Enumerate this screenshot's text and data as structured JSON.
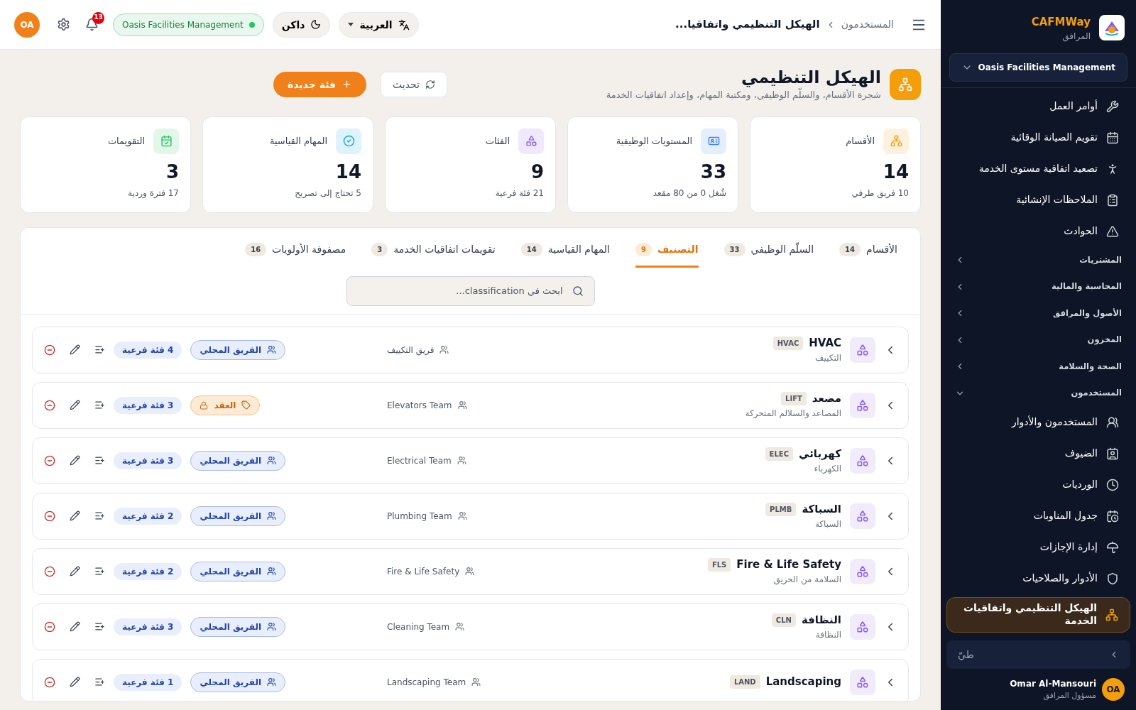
{
  "header": {
    "breadcrumb": [
      "المستخدمون",
      "الهيكل التنظيمي واتفاقيا..."
    ],
    "language": "العربية",
    "theme": "داكن",
    "org_status": "Oasis Facilities Management",
    "notifications": "13",
    "avatar": "OA"
  },
  "page": {
    "title": "الهيكل التنظيمي",
    "subtitle": "شجرة الأقسام، والسلّم الوظيفي، ومكتبة المهام، وإعداد اتفاقيات الخدمة",
    "refresh": "تحديث",
    "new_button": "فئة جديدة"
  },
  "stats": [
    {
      "label": "الأقسام",
      "value": "14",
      "note": "10 فريق طرفي",
      "color": "#f59e0b"
    },
    {
      "label": "المستويات الوظيفية",
      "value": "33",
      "note": "شُغل 0 من 80 مقعد",
      "color": "#3b82f6"
    },
    {
      "label": "الفئات",
      "value": "9",
      "note": "21 فئة فرعية",
      "color": "#8b5cf6"
    },
    {
      "label": "المهام القياسية",
      "value": "14",
      "note": "5 تحتاج إلى تصريح",
      "color": "#0ea5e9"
    },
    {
      "label": "التقويمات",
      "value": "3",
      "note": "17 فترة وردية",
      "color": "#22c55e"
    }
  ],
  "tabs": [
    {
      "label": "الأقسام",
      "count": "14",
      "selected": false
    },
    {
      "label": "السلّم الوظيفي",
      "count": "33",
      "selected": false
    },
    {
      "label": "التصنيف",
      "count": "9",
      "selected": true
    },
    {
      "label": "المهام القياسية",
      "count": "14",
      "selected": false
    },
    {
      "label": "تقويمات اتفاقيات الخدمة",
      "count": "3",
      "selected": false
    },
    {
      "label": "مصفوفة الأولويات",
      "count": "16",
      "selected": false
    }
  ],
  "search": {
    "placeholder": "ابحث في classification..."
  },
  "rows": [
    {
      "name": "HVAC",
      "code": "HVAC",
      "subtitle": "التكييف",
      "team": "فريق التكييف",
      "badge": {
        "kind": "local",
        "label": "الفريق المحلي"
      },
      "subcategories": "4 فئة فرعية"
    },
    {
      "name": "مصعد",
      "code": "LIFT",
      "subtitle": "المصاعد والسلالم المتحركة",
      "team": "Elevators Team",
      "badge": {
        "kind": "contract",
        "label": "العقد"
      },
      "subcategories": "3 فئة فرعية"
    },
    {
      "name": "كهربائي",
      "code": "ELEC",
      "subtitle": "الكهرباء",
      "team": "Electrical Team",
      "badge": {
        "kind": "local",
        "label": "الفريق المحلي"
      },
      "subcategories": "3 فئة فرعية"
    },
    {
      "name": "السباكة",
      "code": "PLMB",
      "subtitle": "السباكة",
      "team": "Plumbing Team",
      "badge": {
        "kind": "local",
        "label": "الفريق المحلي"
      },
      "subcategories": "2 فئة فرعية"
    },
    {
      "name": "Fire & Life Safety",
      "code": "FLS",
      "subtitle": "السلامة من الحريق",
      "team": "Fire & Life Safety",
      "badge": {
        "kind": "local",
        "label": "الفريق المحلي"
      },
      "subcategories": "2 فئة فرعية"
    },
    {
      "name": "النظافة",
      "code": "CLN",
      "subtitle": "النظافة",
      "team": "Cleaning Team",
      "badge": {
        "kind": "local",
        "label": "الفريق المحلي"
      },
      "subcategories": "3 فئة فرعية"
    },
    {
      "name": "Landscaping",
      "code": "LAND",
      "team": "Landscaping Team",
      "badge": {
        "kind": "local",
        "label": "الفريق المحلي"
      },
      "subcategories": "1 فئة فرعية"
    }
  ],
  "sidebar": {
    "brand": "CAFMWay",
    "brand_sub": "المرافق",
    "org": "Oasis Facilities Management",
    "items": [
      {
        "kind": "link",
        "label": "أوامر العمل",
        "selected": false
      },
      {
        "kind": "link",
        "label": "تقويم الصيانة الوقائية",
        "selected": false
      },
      {
        "kind": "link",
        "label": "تصعيد اتفاقية مستوى الخدمة",
        "selected": false
      },
      {
        "kind": "link",
        "label": "الملاحظات الإنشائية",
        "selected": false
      },
      {
        "kind": "link",
        "label": "الحوادث",
        "selected": false
      },
      {
        "kind": "section",
        "label": "المشتريات",
        "expanded": false
      },
      {
        "kind": "section",
        "label": "المحاسبة والمالية",
        "expanded": false
      },
      {
        "kind": "section",
        "label": "الأصول والمرافق",
        "expanded": false
      },
      {
        "kind": "section",
        "label": "المخزون",
        "expanded": false
      },
      {
        "kind": "section",
        "label": "الصحة والسلامة",
        "expanded": false
      },
      {
        "kind": "section",
        "label": "المستخدمون",
        "expanded": true
      },
      {
        "kind": "link",
        "label": "المستخدمون والأدوار",
        "selected": false
      },
      {
        "kind": "link",
        "label": "الضيوف",
        "selected": false
      },
      {
        "kind": "link",
        "label": "الورديات",
        "selected": false
      },
      {
        "kind": "link",
        "label": "جدول المناوبات",
        "selected": false
      },
      {
        "kind": "link",
        "label": "إدارة الإجازات",
        "selected": false
      },
      {
        "kind": "link",
        "label": "الأدوار والصلاحيات",
        "selected": false
      },
      {
        "kind": "link",
        "label": "الهيكل التنظيمي واتفاقيات الخدمة",
        "selected": true
      }
    ],
    "collapse": "طيّ",
    "user": {
      "name": "Omar Al-Mansouri",
      "role": "مسؤول المرافق",
      "initials": "OA"
    }
  }
}
